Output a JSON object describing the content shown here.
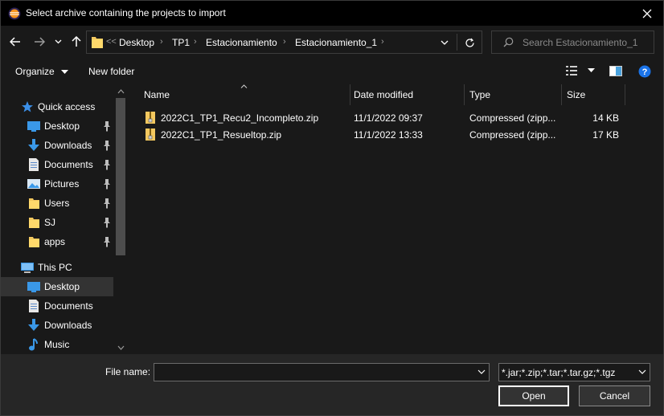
{
  "window": {
    "title": "Select archive containing the projects to import"
  },
  "address": {
    "overflow": "<<",
    "crumbs": [
      "Desktop",
      "TP1",
      "Estacionamiento",
      "Estacionamiento_1"
    ]
  },
  "search": {
    "placeholder": "Search Estacionamiento_1"
  },
  "toolbar": {
    "organize_label": "Organize",
    "new_folder_label": "New folder"
  },
  "nav": {
    "quick_access": "Quick access",
    "quick_items": [
      "Desktop",
      "Downloads",
      "Documents",
      "Pictures",
      "Users",
      "SJ",
      "apps"
    ],
    "this_pc": "This PC",
    "pc_items": [
      "Desktop",
      "Documents",
      "Downloads",
      "Music"
    ],
    "selected": "Desktop"
  },
  "files": {
    "columns": [
      "Name",
      "Date modified",
      "Type",
      "Size"
    ],
    "rows": [
      {
        "name": "2022C1_TP1_Recu2_Incompleto.zip",
        "date": "11/1/2022 09:37",
        "type": "Compressed (zipp...",
        "size": "14 KB"
      },
      {
        "name": "2022C1_TP1_Resueltop.zip",
        "date": "11/1/2022 13:33",
        "type": "Compressed (zipp...",
        "size": "17 KB"
      }
    ]
  },
  "footer": {
    "file_name_label": "File name:",
    "file_name_value": "",
    "filter": "*.jar;*.zip;*.tar;*.tar.gz;*.tgz",
    "open_label": "Open",
    "cancel_label": "Cancel"
  },
  "colors": {
    "accent": "#0078d7",
    "folder": "#f3c85f",
    "background": "#191919"
  }
}
